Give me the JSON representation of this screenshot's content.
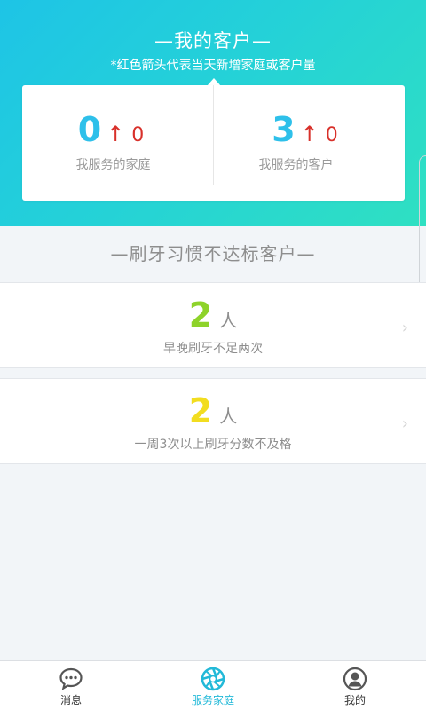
{
  "header": {
    "title": "—我的客户—",
    "subtitle": "*红色箭头代表当天新增家庭或客户量"
  },
  "stats": [
    {
      "value": "0",
      "arrow": "↑",
      "new": "0",
      "label": "我服务的家庭"
    },
    {
      "value": "3",
      "arrow": "↑",
      "new": "0",
      "label": "我服务的客户"
    }
  ],
  "section": {
    "title": "—刷牙习惯不达标客户—"
  },
  "habits": [
    {
      "count": "2",
      "unit": "人",
      "desc": "早晚刷牙不足两次"
    },
    {
      "count": "2",
      "unit": "人",
      "desc": "一周3次以上刷牙分数不及格"
    }
  ],
  "tabbar": {
    "tabs": [
      {
        "label": "消息",
        "icon": "chat-bubble-icon"
      },
      {
        "label": "服务家庭",
        "icon": "aperture-icon"
      },
      {
        "label": "我的",
        "icon": "user-avatar-icon"
      }
    ],
    "active_index": 1
  },
  "colors": {
    "header_gradient_start": "#1ec4e6",
    "header_gradient_end": "#2fe0c2",
    "stat_value": "#2ec0ea",
    "new_arrow": "#d8302a",
    "habit_green": "#8ed32a",
    "habit_yellow": "#f2dd20",
    "active_tab": "#22b9d8"
  }
}
